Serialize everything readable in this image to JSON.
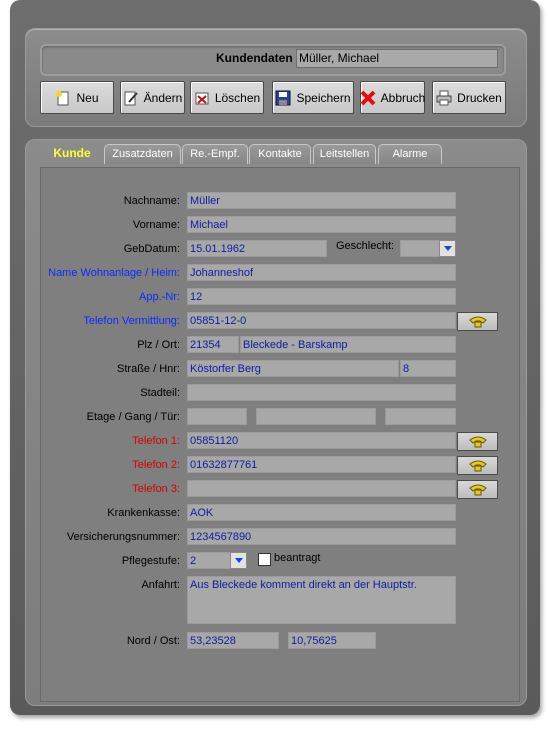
{
  "header": {
    "title_label": "Kundendaten",
    "title_value": "Müller, Michael"
  },
  "toolbar": [
    {
      "label": "Neu",
      "icon": "new-doc-icon"
    },
    {
      "label": "Ändern",
      "icon": "edit-icon"
    },
    {
      "label": "Löschen",
      "icon": "delete-icon"
    },
    {
      "label": "Speichern",
      "icon": "save-icon"
    },
    {
      "label": "Abbruch",
      "icon": "cancel-icon"
    },
    {
      "label": "Drucken",
      "icon": "printer-icon"
    }
  ],
  "tabs": [
    "Kunde",
    "Zusatzdaten",
    "Re.-Empf.",
    "Kontakte",
    "Leitstellen",
    "Alarme"
  ],
  "form": {
    "nachname": {
      "label": "Nachname:",
      "value": "Müller"
    },
    "vorname": {
      "label": "Vorname:",
      "value": "Michael"
    },
    "gebdatum": {
      "label": "GebDatum:",
      "value": "15.01.1962"
    },
    "geschlecht": {
      "label": "Geschlecht:",
      "value": ""
    },
    "wohnanlage": {
      "label": "Name Wohnanlage / Heim:",
      "value": "Johanneshof"
    },
    "appnr": {
      "label": "App.-Nr:",
      "value": "12"
    },
    "tel_vermittlung": {
      "label": "Telefon Vermittlung:",
      "value": "05851-12-0"
    },
    "plz_ort": {
      "label": "Plz / Ort:",
      "plz": "21354",
      "ort": "Bleckede - Barskamp"
    },
    "strasse": {
      "label": "Straße / Hnr:",
      "strasse": "Köstorfer Berg",
      "hnr": "8"
    },
    "stadtteil": {
      "label": "Stadteil:",
      "value": ""
    },
    "etage": {
      "label": "Etage / Gang / Tür:",
      "etage": "",
      "gang": "",
      "tuer": ""
    },
    "telefon1": {
      "label": "Telefon 1:",
      "value": "05851120"
    },
    "telefon2": {
      "label": "Telefon 2:",
      "value": "01632877761"
    },
    "telefon3": {
      "label": "Telefon 3:",
      "value": ""
    },
    "krankenkasse": {
      "label": "Krankenkasse:",
      "value": "AOK"
    },
    "versicherungsnummer": {
      "label": "Versicherungsnummer:",
      "value": "1234567890"
    },
    "pflegestufe": {
      "label": "Pflegestufe:",
      "value": "2",
      "beantragt_label": "beantragt"
    },
    "anfahrt": {
      "label": "Anfahrt:",
      "value": "Aus Bleckede komment direkt an der Hauptstr."
    },
    "koordinaten": {
      "label": "Nord / Ost:",
      "nord": "53,23528",
      "ost": "10,75625"
    }
  },
  "colors": {
    "blue_label": "#0a2cff",
    "red_label": "#d60000",
    "active_tab": "#ffff33"
  }
}
